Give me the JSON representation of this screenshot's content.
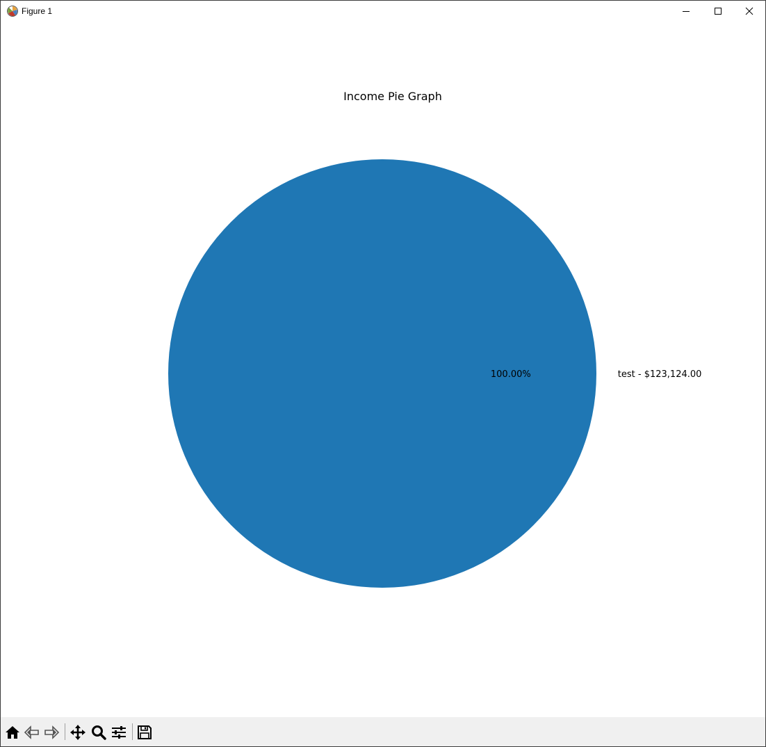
{
  "window": {
    "title": "Figure 1",
    "controls": [
      "minimize",
      "maximize",
      "close"
    ]
  },
  "toolbar": {
    "buttons": [
      {
        "name": "home",
        "icon": "home-icon"
      },
      {
        "name": "back",
        "icon": "arrow-left-icon"
      },
      {
        "name": "forward",
        "icon": "arrow-right-icon"
      },
      {
        "name": "pan",
        "icon": "move-icon"
      },
      {
        "name": "zoom",
        "icon": "magnifier-icon"
      },
      {
        "name": "configure-subplots",
        "icon": "sliders-icon"
      },
      {
        "name": "save",
        "icon": "floppy-disk-icon"
      }
    ]
  },
  "chart_data": {
    "type": "pie",
    "title": "Income Pie Graph",
    "categories": [
      "test - $123,124.00"
    ],
    "values": [
      123124.0
    ],
    "percent_labels": [
      "100.00%"
    ],
    "colors": [
      "#1f77b4"
    ]
  }
}
